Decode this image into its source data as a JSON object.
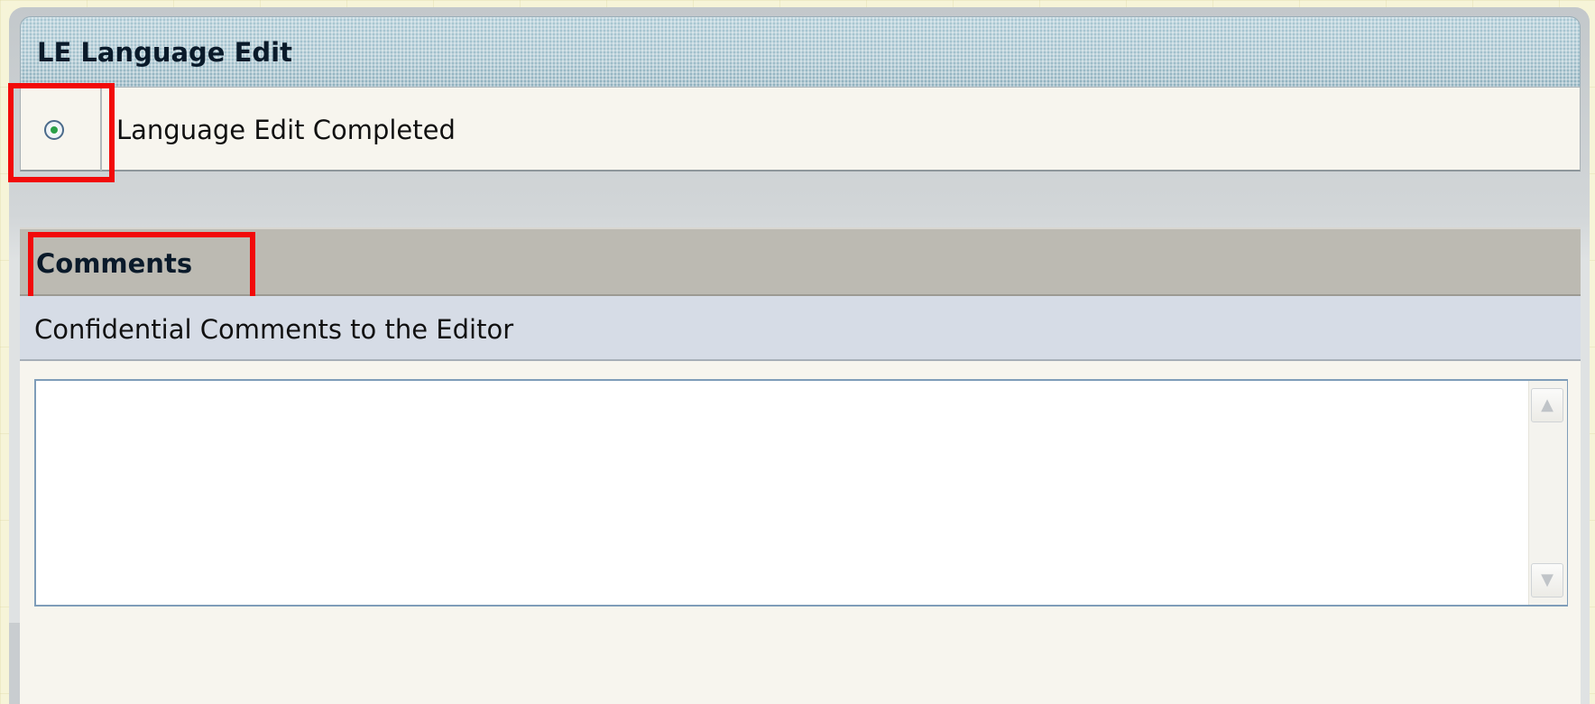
{
  "language_edit_section": {
    "title": "LE Language Edit",
    "option": {
      "label": "Language Edit Completed",
      "selected": true
    }
  },
  "comments_section": {
    "title": "Comments",
    "subheader": "Confidential Comments to the Editor",
    "textarea_value": "",
    "scroll_up_icon": "chevron-up-icon",
    "scroll_down_icon": "chevron-down-icon"
  },
  "colors": {
    "highlight_border": "#f20a0a",
    "radio_dot": "#2aa048"
  }
}
